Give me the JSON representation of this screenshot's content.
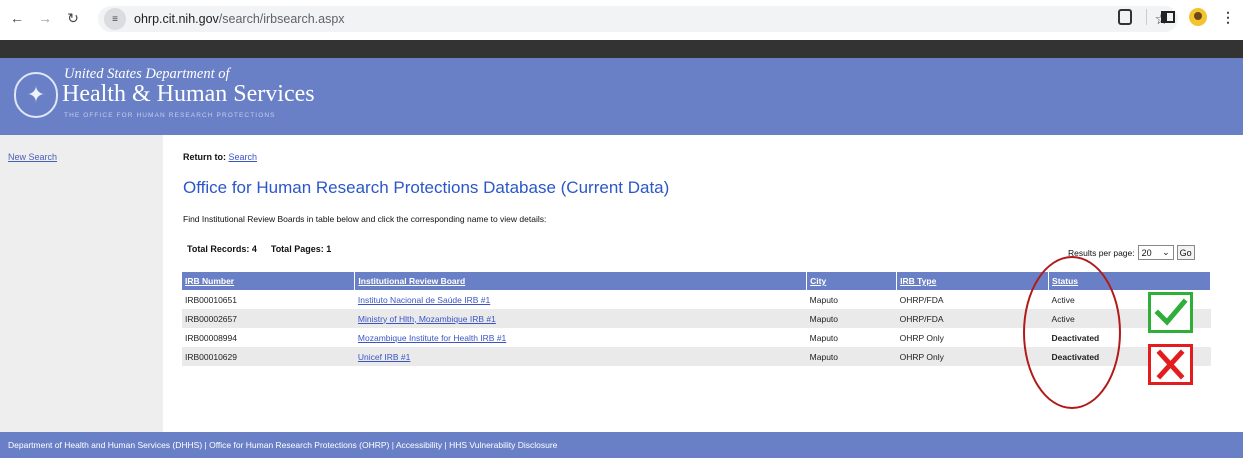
{
  "browser": {
    "url_host": "ohrp.cit.nih.gov",
    "url_path": "/search/irbsearch.aspx"
  },
  "banner": {
    "dept": "United States Department of",
    "hhs": "Health & Human Services",
    "sub": "THE OFFICE FOR HUMAN RESEARCH PROTECTIONS"
  },
  "sidebar": {
    "new_search": "New Search"
  },
  "content": {
    "return_label": "Return to:",
    "return_link": "Search",
    "title": "Office for Human Research Protections Database (Current Data)",
    "instructions": "Find Institutional Review Boards in table below and click the corresponding name to view details:",
    "total_records_label": "Total Records: 4",
    "total_pages_label": "Total Pages: 1",
    "results_per_page_label": "Results per page:",
    "results_per_page_value": "20",
    "go_label": "Go"
  },
  "table": {
    "headers": [
      "IRB Number",
      "Institutional Review Board",
      "City",
      "IRB Type",
      "Status"
    ],
    "rows": [
      {
        "irb_number": "IRB00010651",
        "name": "Instituto Nacional de Saúde IRB #1",
        "city": "Maputo",
        "type": "OHRP/FDA",
        "status": "Active"
      },
      {
        "irb_number": "IRB00002657",
        "name": "Ministry of Hlth, Mozambique IRB #1",
        "city": "Maputo",
        "type": "OHRP/FDA",
        "status": "Active"
      },
      {
        "irb_number": "IRB00008994",
        "name": "Mozambique Institute for Health IRB #1",
        "city": "Maputo",
        "type": "OHRP Only",
        "status": "Deactivated"
      },
      {
        "irb_number": "IRB00010629",
        "name": "Unicef IRB #1",
        "city": "Maputo",
        "type": "OHRP Only",
        "status": "Deactivated"
      }
    ]
  },
  "colors": {
    "banner": "#6a80c6",
    "link": "#3b55c4",
    "deactivated": "#e21b1b",
    "check": "#2fae3a",
    "cross": "#e31d1d"
  },
  "footer": {
    "text": "Department of Health and Human Services (DHHS)  |  Office for Human Research Protections (OHRP)  |  Accessibility  |  HHS Vulnerability Disclosure"
  }
}
